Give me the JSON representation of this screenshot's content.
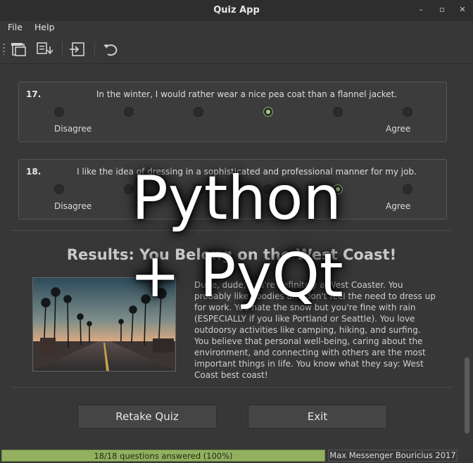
{
  "window": {
    "title": "Quiz App"
  },
  "menu": {
    "file": "File",
    "help": "Help"
  },
  "toolbar": {
    "icons": [
      "new-window-icon",
      "download-icon",
      "exit-icon",
      "undo-icon"
    ]
  },
  "questions": [
    {
      "number": "17.",
      "text": "In the winter, I would rather wear a nice pea coat than a flannel jacket.",
      "left_label": "Disagree",
      "right_label": "Agree",
      "selected_index": 3
    },
    {
      "number": "18.",
      "text": "I like the idea of dressing in a sophisticated and professional manner for my job.",
      "left_label": "Disagree",
      "right_label": "Agree",
      "selected_index": 4
    }
  ],
  "results": {
    "title": "Results: You Belong on the West Coast!",
    "description": "Dude, dude, you're definitely a West Coaster. You probably like hoodies and don't feel the need to dress up for work. You hate the snow but you're fine with rain (ESPECIALLY if you like Portland or Seattle). You love outdoorsy activities like camping, hiking, and surfing. You believe that personal well-being, caring about the environment, and connecting with others are the most important things in life. You know what they say: West Coast best coast!"
  },
  "buttons": {
    "retake": "Retake Quiz",
    "exit": "Exit"
  },
  "status": {
    "progress_text": "18/18 questions answered (100%)",
    "progress_fraction": 1.0,
    "credit": "Max Messenger Bouricius 2017"
  },
  "overlay": {
    "line1": "Python",
    "line2": "+ PyQt"
  },
  "colors": {
    "accent": "#a9cf83",
    "progress": "#92b060",
    "background": "#373737"
  }
}
